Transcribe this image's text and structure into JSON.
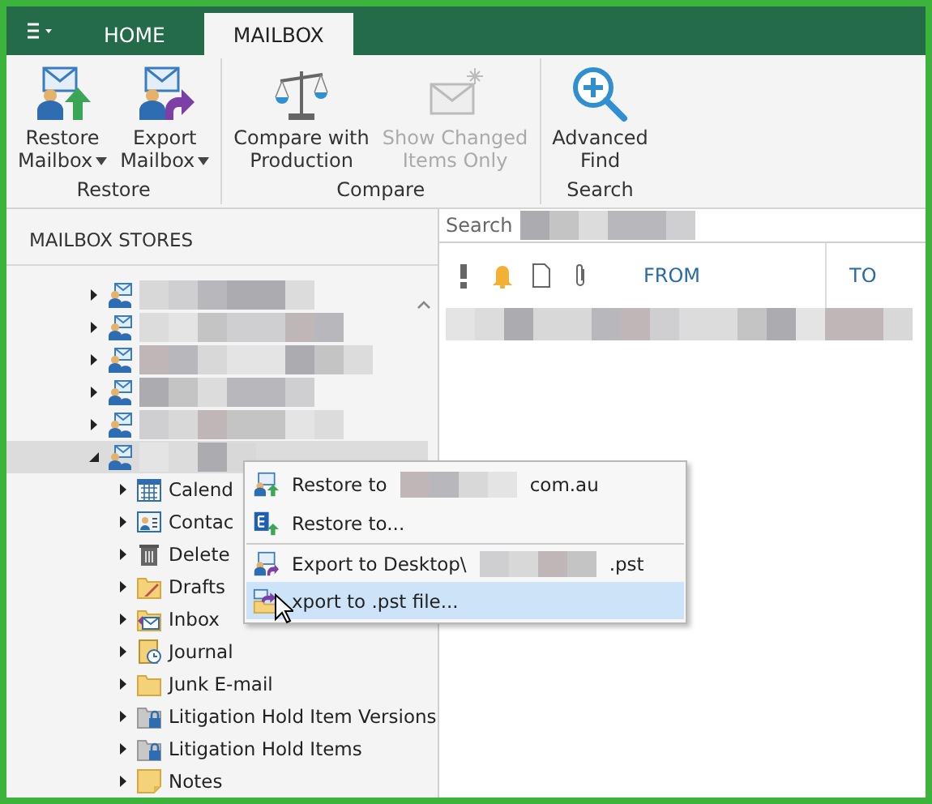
{
  "tabs": [
    {
      "label": "HOME",
      "selected": false
    },
    {
      "label": "MAILBOX",
      "selected": true
    }
  ],
  "ribbon": [
    {
      "label": "Restore",
      "buttons": [
        {
          "kind": "restore",
          "lines": [
            "Restore",
            "Mailbox"
          ],
          "dropdown": true,
          "disabled": false
        },
        {
          "kind": "export",
          "lines": [
            "Export",
            "Mailbox"
          ],
          "dropdown": true,
          "disabled": false
        }
      ]
    },
    {
      "label": "Compare",
      "buttons": [
        {
          "kind": "compare",
          "lines": [
            "Compare with",
            "Production"
          ],
          "dropdown": false,
          "disabled": false
        },
        {
          "kind": "changed",
          "lines": [
            "Show Changed",
            "Items Only"
          ],
          "dropdown": false,
          "disabled": true
        }
      ]
    },
    {
      "label": "Search",
      "buttons": [
        {
          "kind": "find",
          "lines": [
            "Advanced",
            "Find"
          ],
          "dropdown": false,
          "disabled": false
        }
      ]
    }
  ],
  "left_pane": {
    "title": "MAILBOX STORES",
    "mailboxes": [
      {
        "expanded": false,
        "selected": false
      },
      {
        "expanded": false,
        "selected": false
      },
      {
        "expanded": false,
        "selected": false
      },
      {
        "expanded": false,
        "selected": false
      },
      {
        "expanded": false,
        "selected": false
      },
      {
        "expanded": true,
        "selected": true,
        "children": [
          {
            "kind": "calendar",
            "label": "Calend",
            "expanded": false
          },
          {
            "kind": "contacts",
            "label": "Contac",
            "expanded": false
          },
          {
            "kind": "trash",
            "label": "Delete",
            "expanded": false
          },
          {
            "kind": "drafts",
            "label": "Drafts",
            "expanded": false
          },
          {
            "kind": "inbox",
            "label": "Inbox",
            "expanded": false
          },
          {
            "kind": "journal",
            "label": "Journal",
            "expanded": false
          },
          {
            "kind": "folder",
            "label": "Junk E-mail",
            "expanded": false
          },
          {
            "kind": "locked",
            "label": "Litigation Hold Item Versions",
            "expanded": false
          },
          {
            "kind": "locked",
            "label": "Litigation Hold Items",
            "expanded": false
          },
          {
            "kind": "notes",
            "label": "Notes",
            "expanded": false
          }
        ]
      }
    ]
  },
  "context_menu": {
    "items": [
      {
        "kind": "restore",
        "label": "Restore to",
        "redacted": true,
        "suffix": "com.au",
        "selected": false,
        "separator_after": false
      },
      {
        "kind": "exchange",
        "label": "Restore to...",
        "redacted": false,
        "selected": false,
        "separator_after": true
      },
      {
        "kind": "export",
        "label": "Export to Desktop\\",
        "redacted": true,
        "suffix": ".pst",
        "selected": false,
        "separator_after": false
      },
      {
        "kind": "pst",
        "label": "xport to .pst file...",
        "redacted": false,
        "selected": true,
        "separator_after": false
      }
    ]
  },
  "right_pane": {
    "search": {
      "placeholder": "Search"
    },
    "columns": [
      {
        "label": "FROM"
      },
      {
        "label": "TO"
      }
    ]
  }
}
